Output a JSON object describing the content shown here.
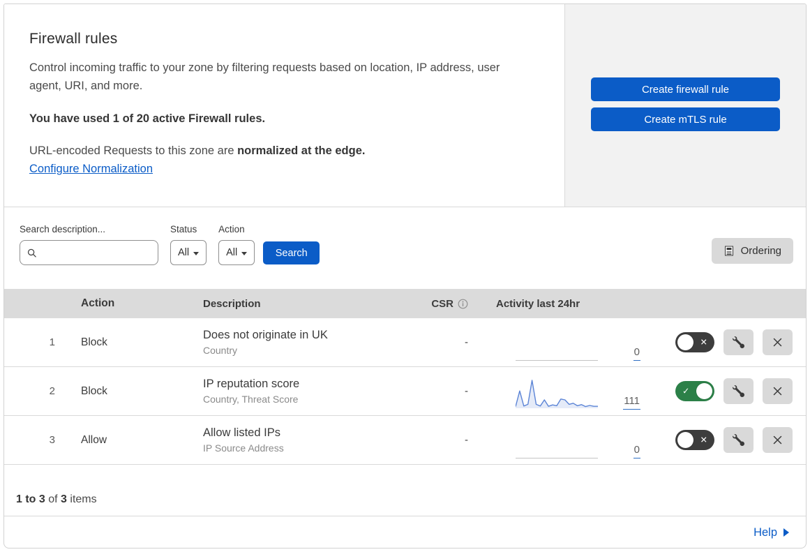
{
  "colors": {
    "primary_blue": "#0b5cc7",
    "link_blue": "#0b5cc7",
    "toggle_on_green": "#2c8048",
    "toggle_off_dark": "#3d3d3d",
    "sparkline_blue": "#5b84d6",
    "side_panel_gray": "#f2f2f2",
    "table_header_gray": "#dbdbdb",
    "control_gray": "#d9d9d9"
  },
  "icons": {
    "search": "magnifier",
    "dropdown": "triangle-down-caret",
    "ordering": "document-list",
    "csr_info": "info-circle",
    "toggle_on": "check",
    "toggle_off": "cross",
    "edit_rule": "wrench",
    "delete_rule": "x-close",
    "help": "right-arrow-triangle"
  },
  "header": {
    "title": "Firewall rules",
    "description": "Control incoming traffic to your zone by filtering requests based on location, IP address, user agent, URI, and more.",
    "usage": "You have used 1 of 20 active Firewall rules.",
    "normalization_prefix": "URL-encoded Requests to this zone are ",
    "normalization_bold": "normalized at the edge.",
    "normalization_link": "Configure Normalization",
    "create_firewall_button": "Create firewall rule",
    "create_mtls_button": "Create mTLS rule"
  },
  "filters": {
    "search_label": "Search description...",
    "search_value": "",
    "status_label": "Status",
    "status_value": "All",
    "action_label": "Action",
    "action_value": "All",
    "search_button": "Search",
    "ordering_button": "Ordering"
  },
  "table": {
    "columns": {
      "action": "Action",
      "description": "Description",
      "csr": "CSR",
      "activity": "Activity last 24hr"
    },
    "rules": [
      {
        "priority": "1",
        "action": "Block",
        "description": "Does not originate in UK",
        "fields": "Country",
        "csr": "-",
        "activity_count": "0",
        "enabled": false,
        "spark": {
          "flat": true
        }
      },
      {
        "priority": "2",
        "action": "Block",
        "description": "IP reputation score",
        "fields": "Country, Threat Score",
        "csr": "-",
        "activity_count": "111",
        "enabled": true,
        "spark": {
          "flat": false,
          "color": "#5b84d6",
          "fill": "rgba(91,132,214,0.16)",
          "points": [
            6,
            62,
            8,
            14,
            100,
            14,
            8,
            30,
            7,
            12,
            9,
            33,
            30,
            14,
            18,
            9,
            13,
            6,
            10,
            7,
            7
          ]
        }
      },
      {
        "priority": "3",
        "action": "Allow",
        "description": "Allow listed IPs",
        "fields": "IP Source Address",
        "csr": "-",
        "activity_count": "0",
        "enabled": false,
        "spark": {
          "flat": true
        }
      }
    ],
    "summary": {
      "range": "1 to 3",
      "of": " of ",
      "total": "3",
      "items": " items"
    }
  },
  "footer": {
    "help_label": "Help"
  }
}
